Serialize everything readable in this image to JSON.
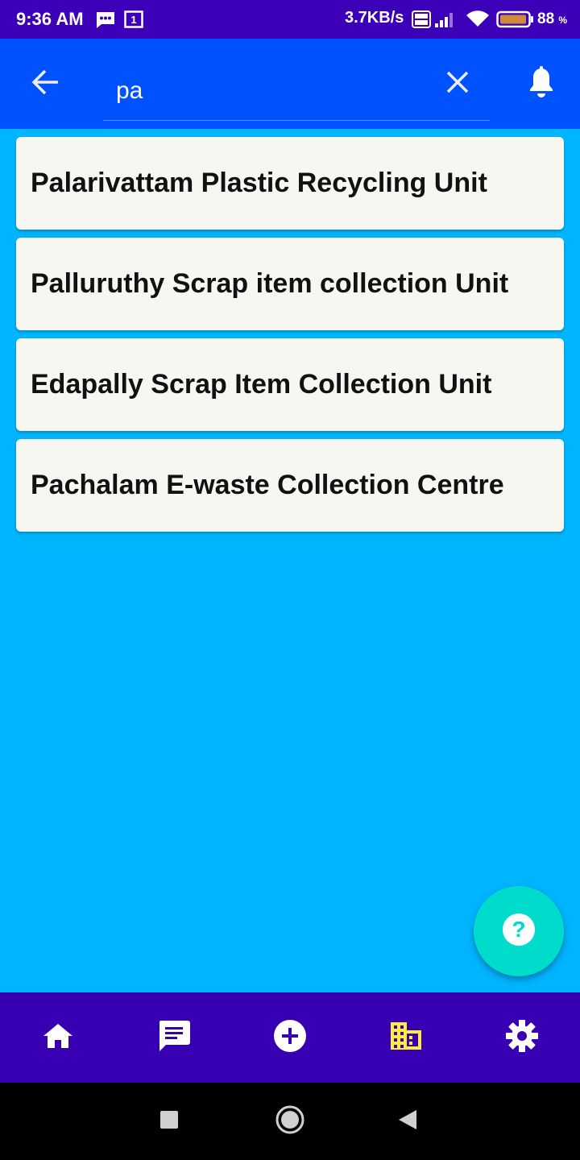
{
  "status_bar": {
    "time": "9:36 AM",
    "network_speed": "3.7KB/s",
    "battery_percent": "88",
    "battery_unit": "%",
    "sim_slot": "1",
    "icons": [
      "messaging-icon",
      "sim-icon",
      "volte-icon",
      "signal-icon",
      "wifi-icon",
      "battery-icon"
    ]
  },
  "app_bar": {
    "search_query": "pa",
    "icons": {
      "back": "arrow-left-icon",
      "clear": "close-icon",
      "notifications": "bell-icon"
    }
  },
  "results": [
    {
      "label": "Palarivattam Plastic Recycling Unit"
    },
    {
      "label": "Palluruthy Scrap item collection Unit"
    },
    {
      "label": "Edapally Scrap Item Collection Unit"
    },
    {
      "label": "Pachalam E-waste Collection Centre"
    }
  ],
  "help_fab": {
    "glyph": "?",
    "icon": "help-icon"
  },
  "bottom_nav": {
    "items": [
      {
        "icon": "home-icon"
      },
      {
        "icon": "chat-icon"
      },
      {
        "icon": "add-circle-icon"
      },
      {
        "icon": "business-icon",
        "active": true
      },
      {
        "icon": "settings-icon"
      }
    ]
  },
  "colors": {
    "status_bar": "#3b00b7",
    "app_bar": "#0051ff",
    "background": "#00b4fd",
    "card": "#f7f7f1",
    "fab": "#00dccc",
    "bottom_nav": "#3700b3",
    "active_nav": "#ffeb3b"
  }
}
